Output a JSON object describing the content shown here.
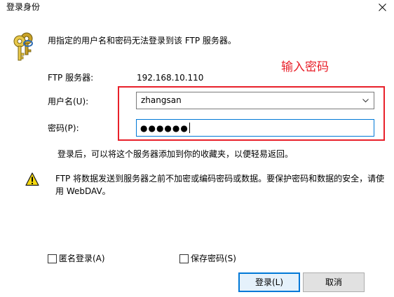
{
  "window": {
    "title": "登录身份"
  },
  "message": "用指定的用户名和密码无法登录到该 FTP 服务器。",
  "ftp_server": {
    "label": "FTP 服务器:",
    "value": "192.168.10.110"
  },
  "annotation": {
    "label": "输入密码",
    "color": "#e8202a"
  },
  "username": {
    "label": "用户名(U):",
    "value": "zhangsan"
  },
  "password": {
    "label": "密码(P):",
    "masked_value": "●●●●●●"
  },
  "note": "登录后，可以将这个服务器添加到你的收藏夹，以便轻易返回。",
  "warning": {
    "line1": "FTP 将数据发送到服务器之前不加密或编码密码或数据。要保护密码和数据的安全，请使",
    "line2": "用 WebDAV。"
  },
  "checkboxes": {
    "anonymous_label": "匿名登录(A)",
    "anonymous_checked": false,
    "save_password_label": "保存密码(S)",
    "save_password_checked": false
  },
  "buttons": {
    "login_label": "登录(L)",
    "cancel_label": "取消"
  },
  "icons": {
    "title_close": "close-icon",
    "keys": "keys-icon",
    "warning": "warning-icon",
    "dropdown": "chevron-down-icon"
  },
  "colors": {
    "focus_border": "#0078d7",
    "button_face": "#e1e1e1",
    "default_button_face": "#e5f1fb"
  }
}
